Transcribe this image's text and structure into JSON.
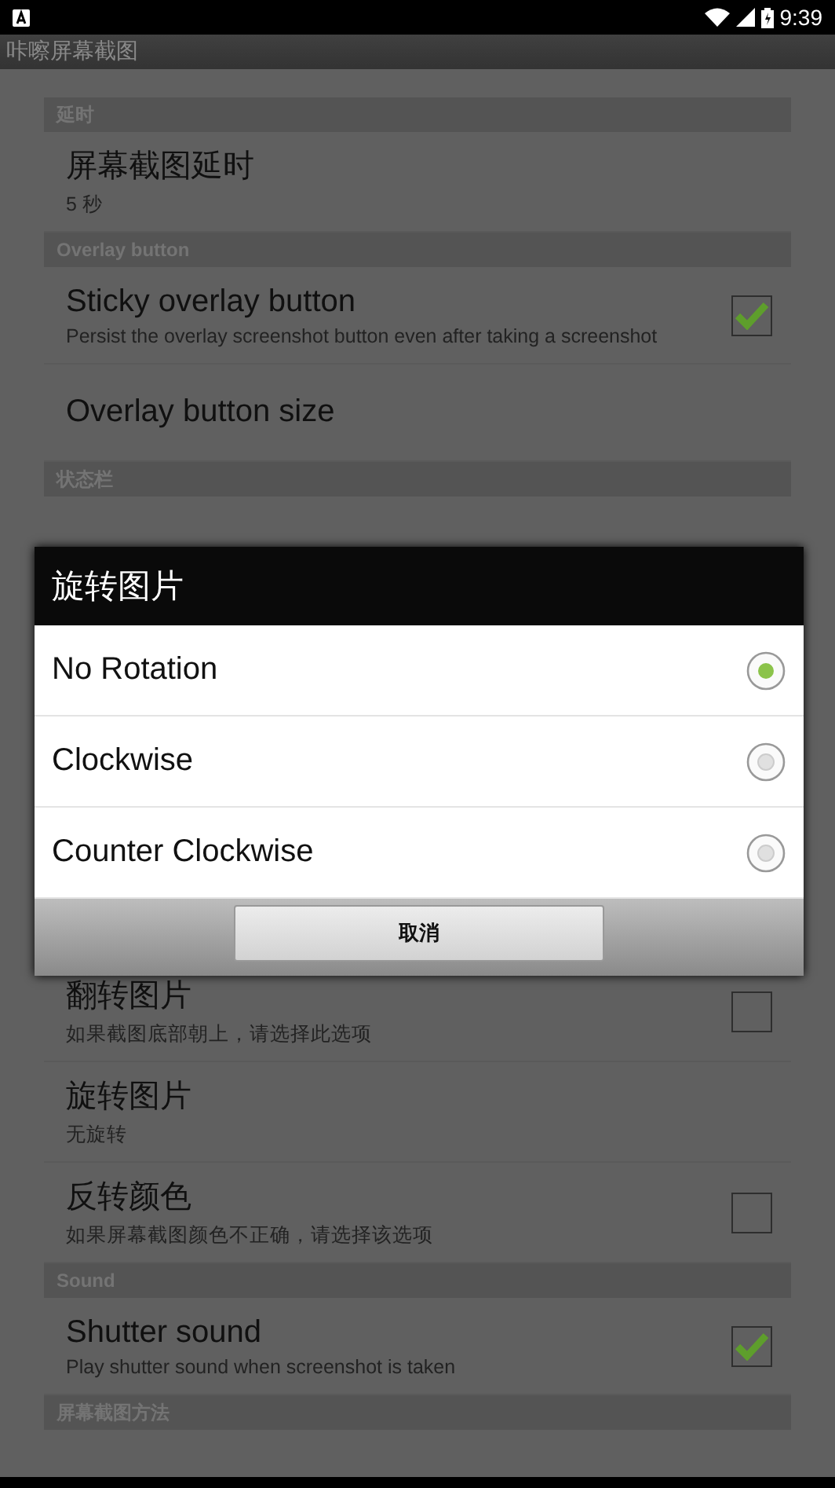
{
  "status_bar": {
    "time": "9:39"
  },
  "app_bar": {
    "title": "咔嚓屏幕截图"
  },
  "settings": [
    {
      "kind": "header",
      "title": "延时"
    },
    {
      "kind": "item",
      "title": "屏幕截图延时",
      "summary": "5 秒"
    },
    {
      "kind": "header",
      "title": "Overlay button"
    },
    {
      "kind": "check",
      "title": "Sticky overlay button",
      "summary": "Persist the overlay screenshot button even after taking a screenshot",
      "checked": true
    },
    {
      "kind": "item",
      "title": "Overlay button size"
    },
    {
      "kind": "header",
      "title": "状态栏"
    },
    {
      "kind": "gap"
    },
    {
      "kind": "check",
      "title": "翻转图片",
      "summary": "如果截图底部朝上，请选择此选项",
      "checked": false
    },
    {
      "kind": "item",
      "title": "旋转图片",
      "summary": "无旋转"
    },
    {
      "kind": "check",
      "title": "反转颜色",
      "summary": "如果屏幕截图颜色不正确，请选择该选项",
      "checked": false
    },
    {
      "kind": "header",
      "title": "Sound"
    },
    {
      "kind": "check",
      "title": "Shutter sound",
      "summary": "Play shutter sound when screenshot is taken",
      "checked": true
    },
    {
      "kind": "header",
      "title": "屏幕截图方法"
    }
  ],
  "dialog": {
    "title": "旋转图片",
    "options": [
      {
        "label": "No Rotation",
        "selected": true
      },
      {
        "label": "Clockwise",
        "selected": false
      },
      {
        "label": "Counter Clockwise",
        "selected": false
      }
    ],
    "cancel": "取消"
  }
}
